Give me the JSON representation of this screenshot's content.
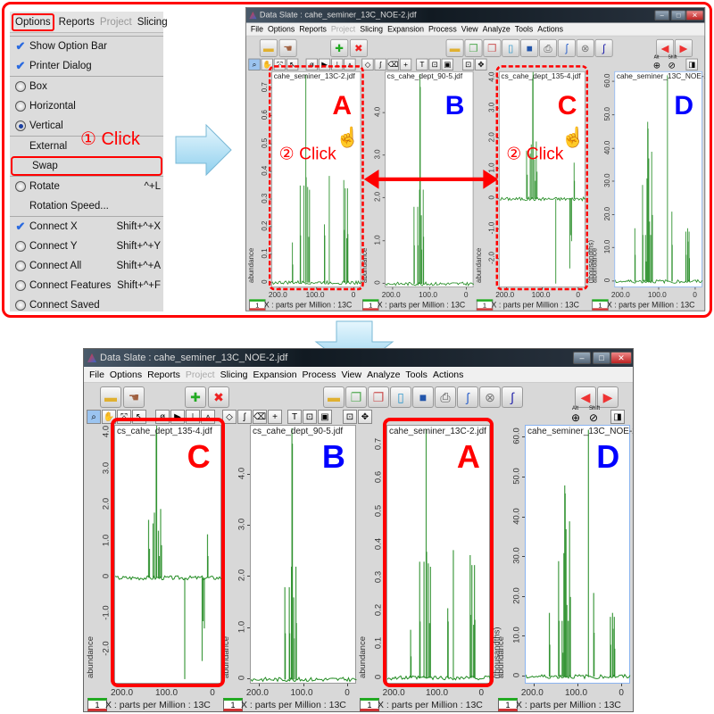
{
  "menu": {
    "header": [
      {
        "label": "Options",
        "active": true
      },
      {
        "label": "Reports"
      },
      {
        "label": "Project",
        "disabled": true
      },
      {
        "label": "Slicing"
      }
    ],
    "items": [
      {
        "label": "Show Option Bar",
        "mark": "check",
        "on": true
      },
      {
        "label": "Printer Dialog",
        "mark": "check",
        "on": true
      },
      {
        "sep": true
      },
      {
        "label": "Box",
        "mark": "radio",
        "on": false
      },
      {
        "label": "Horizontal",
        "mark": "radio",
        "on": false
      },
      {
        "label": "Vertical",
        "mark": "radio",
        "on": true
      },
      {
        "sep": true
      },
      {
        "label": "External",
        "mark": "none"
      },
      {
        "label": "Swap",
        "mark": "none",
        "highlight": true
      },
      {
        "sep": true
      },
      {
        "label": "Rotate",
        "mark": "radio",
        "on": false,
        "shortcut": "^+L"
      },
      {
        "label": "Rotation Speed...",
        "mark": "none"
      },
      {
        "sep": true
      },
      {
        "label": "Connect X",
        "mark": "check",
        "on": true,
        "shortcut": "Shift+^+X"
      },
      {
        "label": "Connect Y",
        "mark": "radio",
        "on": false,
        "shortcut": "Shift+^+Y"
      },
      {
        "label": "Connect All",
        "mark": "radio",
        "on": false,
        "shortcut": "Shift+^+A"
      },
      {
        "label": "Connect Features",
        "mark": "radio",
        "on": false,
        "shortcut": "Shift+^+F"
      },
      {
        "label": "Connect Saved",
        "mark": "radio",
        "on": false
      }
    ]
  },
  "annotations": {
    "step1": "① Click",
    "step2": "② Click"
  },
  "window": {
    "title": "Data Slate : cahe_seminer_13C_NOE-2.jdf",
    "menus": [
      {
        "label": "File"
      },
      {
        "label": "Options"
      },
      {
        "label": "Reports"
      },
      {
        "label": "Project",
        "disabled": true
      },
      {
        "label": "Slicing"
      },
      {
        "label": "Expansion"
      },
      {
        "label": "Process"
      },
      {
        "label": "View"
      },
      {
        "label": "Analyze"
      },
      {
        "label": "Tools"
      },
      {
        "label": "Actions"
      }
    ],
    "controls": [
      "–",
      "□",
      "✕"
    ],
    "alt_label": "Alt",
    "shift_label": "Shift",
    "x_label": "X : parts per Million : 13C",
    "x_ticks": [
      "200.0",
      "100.0",
      "0"
    ],
    "y_label": "abundance",
    "thousandths_label": "(thousandths)",
    "badge": "1"
  },
  "spectra": {
    "A": {
      "letter": "A",
      "letter_color": "#ff0000",
      "file": "cahe_seminer_13C-2.jdf",
      "ylim": [
        -0.02,
        0.76
      ],
      "yticks": [
        "0",
        "0.1",
        "0.2",
        "0.3",
        "0.4",
        "0.5",
        "0.6",
        "0.7"
      ],
      "peaks": [
        [
          166,
          0.145
        ],
        [
          165,
          0.065
        ],
        [
          145,
          0.35
        ],
        [
          144,
          0.17
        ],
        [
          135,
          0.35
        ],
        [
          130,
          0.75
        ],
        [
          129,
          0.38
        ],
        [
          125,
          0.345
        ],
        [
          122,
          0.165
        ],
        [
          120,
          0.335
        ],
        [
          80,
          0.21
        ],
        [
          79,
          0.17
        ],
        [
          67,
          0.385
        ],
        [
          28,
          0.37
        ],
        [
          27,
          0.19
        ],
        [
          24,
          0.34
        ],
        [
          20,
          0.16
        ],
        [
          18,
          0.34
        ],
        [
          17,
          0.175
        ]
      ]
    },
    "B": {
      "letter": "B",
      "letter_color": "#0000ff",
      "file": "cs_cahe_dept_90-5.jdf",
      "ylim": [
        -0.1,
        4.95
      ],
      "yticks": [
        "0",
        "1.0",
        "2.0",
        "3.0",
        "4.0"
      ],
      "peaks": [
        [
          143,
          1.8
        ],
        [
          142,
          0.9
        ],
        [
          133,
          1.8
        ],
        [
          132,
          0.9
        ],
        [
          128,
          2.2
        ],
        [
          127,
          4.9
        ],
        [
          126,
          4.6
        ],
        [
          123,
          1.6
        ],
        [
          122,
          0.8
        ],
        [
          118,
          2.2
        ],
        [
          117,
          1.1
        ]
      ]
    },
    "C": {
      "letter": "C",
      "letter_color": "#ff0000",
      "file": "cs_cahe_dept_135-4.jdf",
      "ylim": [
        -2.95,
        4.2
      ],
      "yticks": [
        "-2.0",
        "-1.0",
        "0",
        "1.0",
        "2.0",
        "3.0",
        "4.0"
      ],
      "peaks": [
        [
          145,
          1.6
        ],
        [
          143,
          0.8
        ],
        [
          135,
          1.5
        ],
        [
          132,
          1.8
        ],
        [
          128,
          4.0
        ],
        [
          127,
          4.2
        ],
        [
          123,
          1.3
        ],
        [
          121,
          0.6
        ],
        [
          118,
          1.9
        ],
        [
          116,
          0.9
        ],
        [
          64,
          -2.8
        ],
        [
          25,
          -2.3
        ],
        [
          23,
          -1.2
        ],
        [
          20,
          -1.4
        ],
        [
          13,
          1.2
        ],
        [
          12,
          0.6
        ]
      ]
    },
    "D": {
      "letter": "D",
      "letter_color": "#0000ff",
      "file": "cahe_seminer_13C_NOE-2.jdf",
      "ylim": [
        -2,
        63
      ],
      "yticks": [
        "0",
        "10.0",
        "20.0",
        "30.0",
        "40.0",
        "50.0",
        "60.0"
      ],
      "thousandths": true,
      "selected": true,
      "peaks": [
        [
          166,
          16
        ],
        [
          165,
          8
        ],
        [
          145,
          29
        ],
        [
          144,
          14
        ],
        [
          137,
          14
        ],
        [
          135,
          6
        ],
        [
          133,
          31
        ],
        [
          131,
          48
        ],
        [
          130,
          46
        ],
        [
          128,
          37
        ],
        [
          126,
          18
        ],
        [
          123,
          14
        ],
        [
          120,
          39
        ],
        [
          118,
          20
        ],
        [
          77,
          62
        ],
        [
          65,
          21
        ],
        [
          64,
          11
        ],
        [
          27,
          15
        ],
        [
          26,
          8
        ],
        [
          22,
          16
        ],
        [
          21,
          12
        ],
        [
          18,
          15
        ],
        [
          17,
          7
        ]
      ]
    }
  },
  "x_range_ppm": [
    220,
    -20
  ],
  "before": {
    "order": [
      "A",
      "B",
      "C",
      "D"
    ],
    "highlight": [
      "A",
      "C"
    ]
  },
  "after": {
    "order": [
      "C",
      "B",
      "A",
      "D"
    ],
    "highlight": [
      "C",
      "A"
    ]
  },
  "colors": {
    "annotation": "#ff0000",
    "spectrum": "#228b22",
    "arrow_fill": "#bfe6f8"
  }
}
